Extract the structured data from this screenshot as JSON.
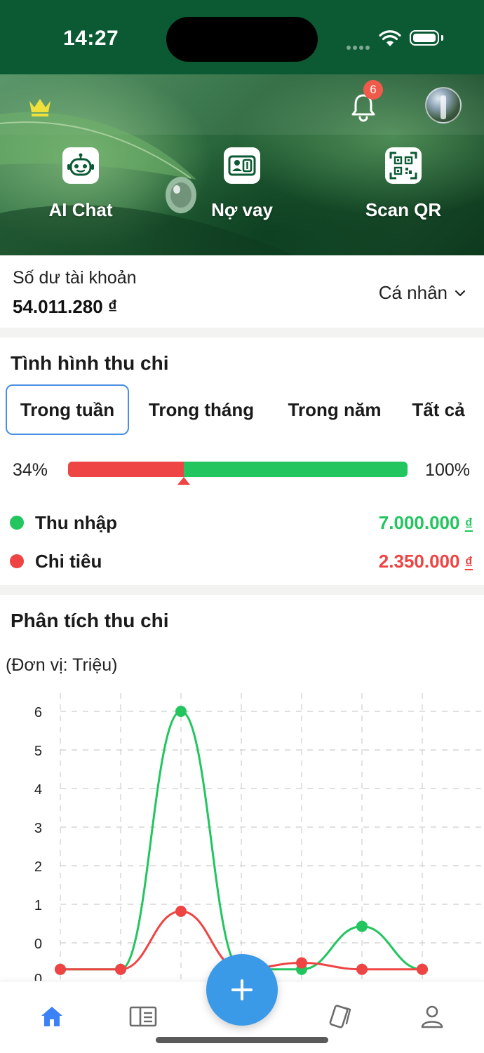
{
  "status_bar": {
    "time": "14:27"
  },
  "header": {
    "notification_count": "6",
    "icons": [
      "crown-icon",
      "bell-icon",
      "avatar"
    ]
  },
  "quick_actions": [
    {
      "label": "AI Chat",
      "icon": "robot-icon"
    },
    {
      "label": "Nợ vay",
      "icon": "loan-card-icon"
    },
    {
      "label": "Scan QR",
      "icon": "qr-code-icon"
    }
  ],
  "balance": {
    "label": "Số dư tài khoản",
    "amount": "54.011.280 ₫",
    "scope": "Cá nhân"
  },
  "summary": {
    "title": "Tình hình thu chi",
    "tabs": [
      "Trong tuần",
      "Trong tháng",
      "Trong năm",
      "Tất cả"
    ],
    "active_tab": 0,
    "ratio_label": "34%",
    "max_label": "100%",
    "expense_ratio": 0.34,
    "income_label": "Thu nhập",
    "income_value": "7.000.000",
    "expense_label": "Chi tiêu",
    "expense_value": "2.350.000",
    "currency": "₫",
    "colors": {
      "income": "#22c55e",
      "expense": "#ef4444"
    }
  },
  "analysis": {
    "title": "Phân tích thu chi",
    "unit": "(Đơn vị: Triệu)"
  },
  "chart_data": {
    "type": "line",
    "y_tick_labels": [
      "6",
      "5",
      "4",
      "3",
      "2",
      "1",
      "0",
      "0"
    ],
    "ylim": [
      -0.2,
      6
    ],
    "grid": true,
    "series": [
      {
        "name": "Thu nhập",
        "color": "#22c55e",
        "values": [
          0,
          0,
          6,
          0,
          0,
          1,
          0
        ]
      },
      {
        "name": "Chi tiêu",
        "color": "#ef4444",
        "values": [
          0,
          0,
          1.35,
          0,
          0.15,
          0,
          0
        ]
      }
    ]
  },
  "bottom_nav": {
    "items": [
      "home-icon",
      "ledger-icon",
      "cards-icon",
      "profile-icon"
    ],
    "fab_icon": "plus-icon",
    "active": 0
  }
}
